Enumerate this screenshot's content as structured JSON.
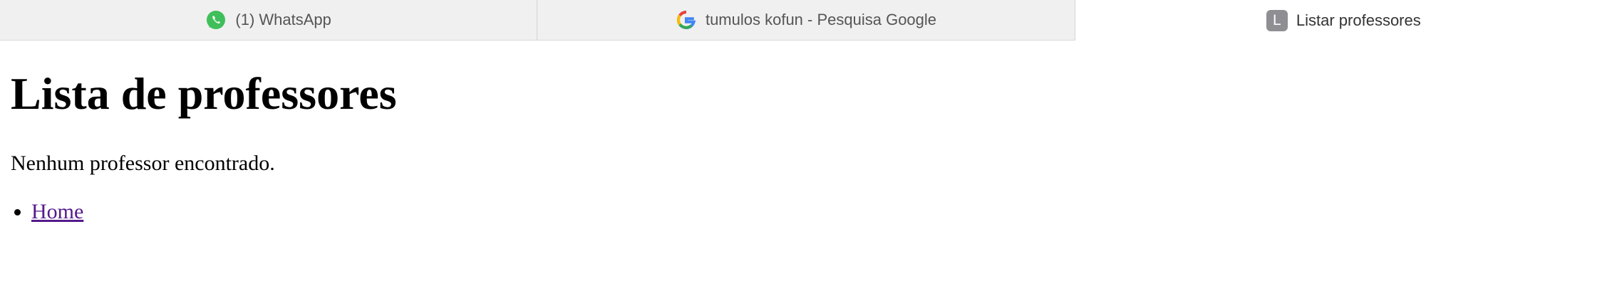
{
  "browser": {
    "tabs": [
      {
        "label": "(1) WhatsApp",
        "icon": "whatsapp-icon",
        "active": false
      },
      {
        "label": "tumulos kofun - Pesquisa Google",
        "icon": "google-icon",
        "active": false
      },
      {
        "label": "Listar professores",
        "icon": "letter-l-icon",
        "icon_letter": "L",
        "active": true
      }
    ]
  },
  "page": {
    "heading": "Lista de professores",
    "message": "Nenhum professor encontrado.",
    "links": [
      {
        "label": "Home"
      }
    ]
  },
  "colors": {
    "whatsapp": "#3fbf5a",
    "visited_link": "#551a8b",
    "letter_icon_bg": "#8e8e93"
  }
}
